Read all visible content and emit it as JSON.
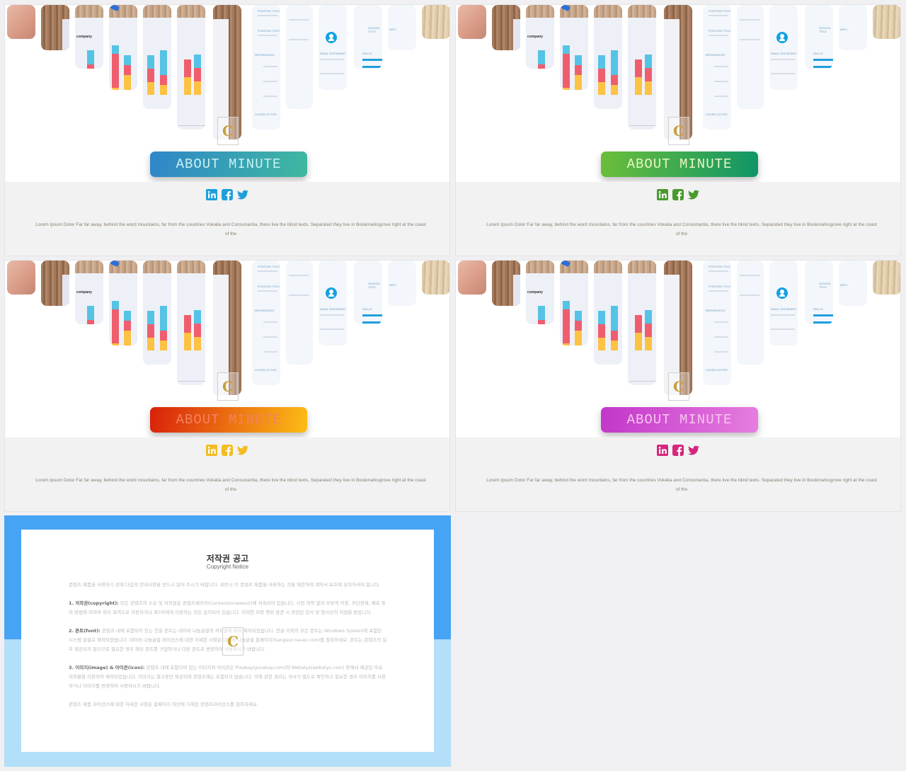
{
  "variants": [
    {
      "id": "blue",
      "button_label": "ABOUT MINUTE",
      "button_gradient": [
        "#2f86c9",
        "#3fb8a0"
      ],
      "button_text_color": "#c9f1f2",
      "social_color": "#1e9fdb",
      "lorem": "Lorem Ipsum Dolor Far far away, behind the word mountains, far from the countries Vokalia and Consonantia, there live the blind texts. Separated they live in Bookmarksgrove right at the coast of the"
    },
    {
      "id": "green",
      "button_label": "ABOUT MINUTE",
      "button_gradient": [
        "#6cbe3a",
        "#0f9568"
      ],
      "button_text_color": "#e6f7c4",
      "social_color": "#4a9a2e",
      "lorem": "Lorem Ipsum Dolor Far far away, behind the word mountains, far from the countries Vokalia and Consonantia, there live the blind texts. Separated they live in Bookmarksgrove right at the coast of the"
    },
    {
      "id": "orange",
      "button_label": "ABOUT MINUTE",
      "button_gradient": [
        "#d9210b",
        "#fcbd17"
      ],
      "button_text_color": "#f4815f",
      "social_color": "#f3bc22",
      "lorem": "Lorem Ipsum Dolor Far far away, behind the word mountains, far from the countries Vokalia and Consonantia, there live the blind texts. Separated they live in Bookmarksgrove right at the coast of the"
    },
    {
      "id": "purple",
      "button_label": "ABOUT MINUTE",
      "button_gradient": [
        "#c236c9",
        "#e77ee0"
      ],
      "button_text_color": "#f7c6ee",
      "social_color": "#d6267d",
      "lorem": "Lorem Ipsum Dolor Far far away, behind the word mountains, far from the countries Vokalia and Consonantia, there live the blind texts. Separated they live in Bookmarksgrove right at the coast of the"
    }
  ],
  "social_icons": [
    "linkedin-icon",
    "facebook-icon",
    "twitter-icon"
  ],
  "hero_strip": {
    "company_text": "company",
    "doc_labels": [
      "POSITION TITLE",
      "POSITION TITLE",
      "REFERENCES",
      "COVER LETTER",
      "EMAIL STATEMENT",
      "SKILLS",
      "SCHOOL TITLE",
      "INFO"
    ]
  },
  "watermark_letter": "C",
  "copyright": {
    "title": "저작권 공고",
    "subtitle": "Copyright Notice",
    "intro": "콘텐츠 제품을 사용하기 전에 다음의 안내사항을 반드시 읽어 주시기 바랍니다. 위반시 이 콘텐츠 제품을 사용하는 것을 제한하며 계약서 보호에 유의하셔야 합니다.",
    "sections": [
      {
        "heading": "1. 저작권(copyright):",
        "text": " 모든 콘텐츠의 소유 및 저작권은 콘텐츠메이커(Contentsmakeout)에 귀속되어 있습니다. 사전 허락 없이 모방적 이용, 무단전재, 배포 등의 방법에 의하여 영리 목적으로 이용하거나 제3자에게 이용하는 것은 금지되어 있습니다. 이러한 모방 행위 발견 시 관련된 민사 및 형사상의 처벌을 받습니다."
      },
      {
        "heading": "2. 폰트(font):",
        "text": " 콘텐츠 내에 포함되어 있는 한글 폰트는 네이버 나눔글꼴의 저작권에 따라 제작되었습니다. 한글 이외의 모든 폰트는 Windows System에 포함된 시스템 글꼴로 제작되었습니다. 네이버 나눔글꼴 라이선스에 대한 자세한 사항은 네이버 나눔글꼴 홈페이지(hangeul.naver.com)를 참조하세요. 폰트는 콘텐츠의 일부 제공되지 않으므로 필요한 경우 해당 폰트를 구입하거나 다른 폰트로 변경하여 사용하시기 바랍니다."
      },
      {
        "heading": "3. 이미지(image) & 아이콘(icon):",
        "text": " 콘텐츠 내에 포함되어 있는 이미지와 아이콘은 Pixabay(pixabay.com)와 Webalys(webalys.com) 등에서 제공된 무료 저작물을 이용하여 제작되었습니다. 이미지는 참고용만 제공되며 콘텐츠에는 포함되지 않습니다. 이에 관한 권리는 귀사가 별도로 확인하고 필요한 경우 이미지를 사용하거나 이미지를 변경하여 사용하시기 바랍니다."
      }
    ],
    "outro": "콘텐츠 제품 라이선스에 대한 자세한 사항은 홈페이지 하단에 기재된 콘텐츠라이선스를 참조하세요.",
    "colors": {
      "top_band": "#47a3f3",
      "bottom_band": "#b3dff8"
    }
  }
}
